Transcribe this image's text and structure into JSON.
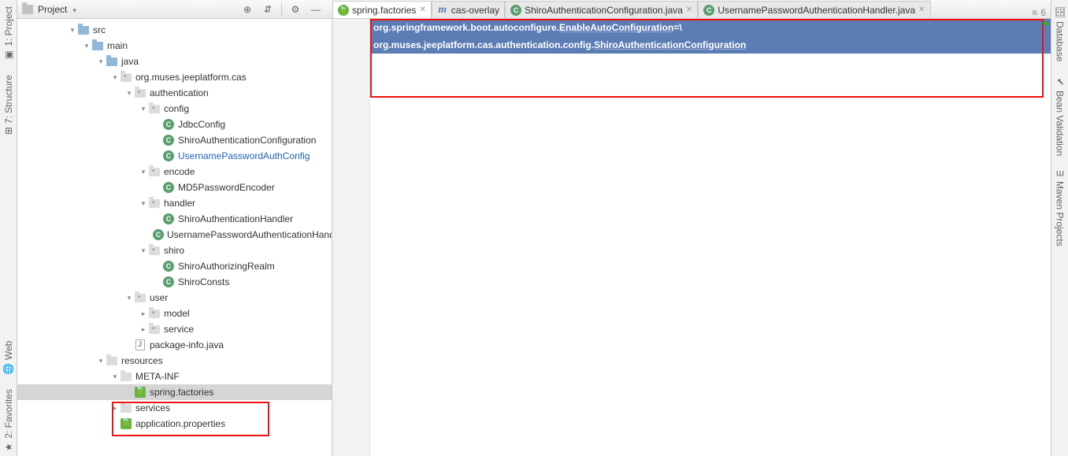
{
  "header": {
    "project_label": "Project",
    "tabs": [
      {
        "icon": "spring",
        "label": "spring.factories",
        "active": true,
        "closable": true
      },
      {
        "icon": "m",
        "label": "cas-overlay",
        "active": false,
        "closable": false
      },
      {
        "icon": "c",
        "label": "ShiroAuthenticationConfiguration.java",
        "active": false,
        "closable": true
      },
      {
        "icon": "c",
        "label": "UsernamePasswordAuthenticationHandler.java",
        "active": false,
        "closable": true
      }
    ],
    "tab_extra": "6"
  },
  "left_tabs": [
    "1: Project",
    "7: Structure",
    "Web",
    "2: Favorites"
  ],
  "right_tabs": [
    "Database",
    "Bean Validation",
    "Maven Projects"
  ],
  "tree": [
    {
      "d": 0,
      "chev": "down",
      "ic": "folder-blue",
      "label": "src"
    },
    {
      "d": 1,
      "chev": "down",
      "ic": "folder-blue",
      "label": "main"
    },
    {
      "d": 2,
      "chev": "down",
      "ic": "folder-blue",
      "label": "java"
    },
    {
      "d": 3,
      "chev": "down",
      "ic": "pkg",
      "label": "org.muses.jeeplatform.cas"
    },
    {
      "d": 4,
      "chev": "down",
      "ic": "pkg",
      "label": "authentication"
    },
    {
      "d": 5,
      "chev": "down",
      "ic": "pkg",
      "label": "config"
    },
    {
      "d": 6,
      "chev": "none",
      "ic": "cls",
      "label": "JdbcConfig"
    },
    {
      "d": 6,
      "chev": "none",
      "ic": "cls",
      "label": "ShiroAuthenticationConfiguration"
    },
    {
      "d": 6,
      "chev": "none",
      "ic": "cls",
      "label": "UsernamePasswordAuthConfig",
      "link": true
    },
    {
      "d": 5,
      "chev": "down",
      "ic": "pkg",
      "label": "encode"
    },
    {
      "d": 6,
      "chev": "none",
      "ic": "cls",
      "label": "MD5PasswordEncoder"
    },
    {
      "d": 5,
      "chev": "down",
      "ic": "pkg",
      "label": "handler"
    },
    {
      "d": 6,
      "chev": "none",
      "ic": "cls",
      "label": "ShiroAuthenticationHandler"
    },
    {
      "d": 6,
      "chev": "none",
      "ic": "cls",
      "label": "UsernamePasswordAuthenticationHandler"
    },
    {
      "d": 5,
      "chev": "down",
      "ic": "pkg",
      "label": "shiro"
    },
    {
      "d": 6,
      "chev": "none",
      "ic": "cls",
      "label": "ShiroAuthorizingRealm"
    },
    {
      "d": 6,
      "chev": "none",
      "ic": "cls",
      "label": "ShiroConsts"
    },
    {
      "d": 4,
      "chev": "down",
      "ic": "pkg",
      "label": "user"
    },
    {
      "d": 5,
      "chev": "right",
      "ic": "pkg",
      "label": "model"
    },
    {
      "d": 5,
      "chev": "right",
      "ic": "pkg",
      "label": "service"
    },
    {
      "d": 4,
      "chev": "none",
      "ic": "java",
      "label": "package-info.java"
    },
    {
      "d": 2,
      "chev": "down",
      "ic": "folder",
      "label": "resources"
    },
    {
      "d": 3,
      "chev": "down",
      "ic": "folder",
      "label": "META-INF"
    },
    {
      "d": 4,
      "chev": "none",
      "ic": "leaf",
      "label": "spring.factories",
      "selected": true
    },
    {
      "d": 3,
      "chev": "right",
      "ic": "folder",
      "label": "services"
    },
    {
      "d": 3,
      "chev": "none",
      "ic": "leaf",
      "label": "application.properties"
    }
  ],
  "code": {
    "line1_a": "org.springframework.boot.autoconfigure.",
    "line1_b": "EnableAutoConfiguration",
    "line1_c": "=\\",
    "line2_a": "org.muses.jeeplatform.cas.authentication.config.",
    "line2_b": "ShiroAuthenticationConfiguration"
  }
}
